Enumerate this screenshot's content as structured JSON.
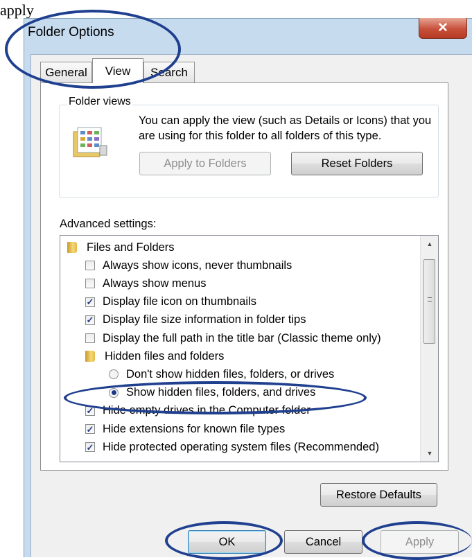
{
  "caption": "apply",
  "dialog": {
    "title": "Folder Options",
    "close_icon": "close-x-icon"
  },
  "tabs": [
    {
      "label": "General",
      "active": false
    },
    {
      "label": "View",
      "active": true
    },
    {
      "label": "Search",
      "active": false
    }
  ],
  "folder_views": {
    "legend": "Folder views",
    "description": "You can apply the view (such as Details or Icons) that you are using for this folder to all folders of this type.",
    "apply_button": "Apply to Folders",
    "reset_button": "Reset Folders"
  },
  "advanced": {
    "label": "Advanced settings:",
    "items": [
      {
        "type": "folder",
        "label": "Files and Folders",
        "level": 0
      },
      {
        "type": "checkbox",
        "label": "Always show icons, never thumbnails",
        "checked": false,
        "level": 1
      },
      {
        "type": "checkbox",
        "label": "Always show menus",
        "checked": false,
        "level": 1
      },
      {
        "type": "checkbox",
        "label": "Display file icon on thumbnails",
        "checked": true,
        "level": 1
      },
      {
        "type": "checkbox",
        "label": "Display file size information in folder tips",
        "checked": true,
        "level": 1
      },
      {
        "type": "checkbox",
        "label": "Display the full path in the title bar (Classic theme only)",
        "checked": false,
        "level": 1
      },
      {
        "type": "folder",
        "label": "Hidden files and folders",
        "level": 1
      },
      {
        "type": "radio",
        "label": "Don't show hidden files, folders, or drives",
        "checked": false,
        "level": 2
      },
      {
        "type": "radio",
        "label": "Show hidden files, folders, and drives",
        "checked": true,
        "level": 2
      },
      {
        "type": "checkbox",
        "label": "Hide empty drives in the Computer folder",
        "checked": true,
        "level": 1
      },
      {
        "type": "checkbox",
        "label": "Hide extensions for known file types",
        "checked": true,
        "level": 1
      },
      {
        "type": "checkbox",
        "label": "Hide protected operating system files (Recommended)",
        "checked": true,
        "level": 1
      }
    ],
    "restore_button": "Restore Defaults"
  },
  "footer": {
    "ok": "OK",
    "cancel": "Cancel",
    "apply": "Apply"
  },
  "colors": {
    "annotation": "#1f3f8f",
    "window_frame": "#c7dbef",
    "close": "#c7503a"
  }
}
